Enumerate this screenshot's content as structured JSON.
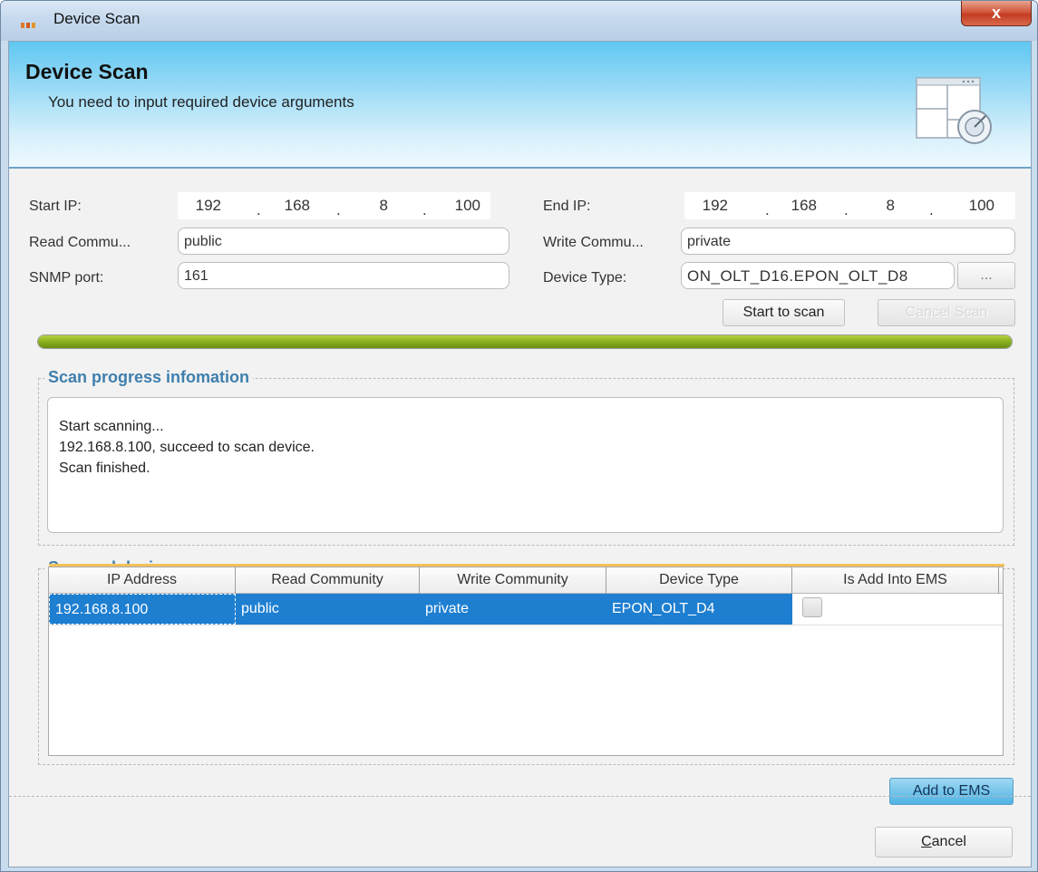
{
  "window": {
    "title": "Device Scan",
    "close_label": "x"
  },
  "header": {
    "title": "Device Scan",
    "subtitle": "You need to input required device arguments"
  },
  "form": {
    "start_ip_label": "Start IP:",
    "start_ip": [
      "192",
      "168",
      "8",
      "100"
    ],
    "end_ip_label": "End IP:",
    "end_ip": [
      "192",
      "168",
      "8",
      "100"
    ],
    "ip_separator": ".",
    "read_community_label": "Read Commu...",
    "read_community_value": "public",
    "write_community_label": "Write Commu...",
    "write_community_value": "private",
    "snmp_port_label": "SNMP port:",
    "snmp_port_value": "161",
    "device_type_label": "Device Type:",
    "device_type_value": "ON_OLT_D16.EPON_OLT_D8",
    "browse_label": "...",
    "start_scan_label": "Start to scan",
    "cancel_scan_label": "Cancel Scan"
  },
  "progress": {
    "percent": 100
  },
  "scan_progress": {
    "title": "Scan progress infomation",
    "lines": [
      "Start scanning...",
      "192.168.8.100, succeed to scan device.",
      "Scan finished."
    ]
  },
  "scanned_devices": {
    "title": "Scanned devices",
    "columns": [
      "IP Address",
      "Read Community",
      "Write Community",
      "Device Type",
      "Is Add Into EMS"
    ],
    "rows": [
      {
        "ip": "192.168.8.100",
        "read_community": "public",
        "write_community": "private",
        "device_type": "EPON_OLT_D4",
        "is_add_into_ems": false,
        "selected": true
      }
    ]
  },
  "footer": {
    "add_to_ems_label": "Add to EMS",
    "cancel_label": "Cancel"
  },
  "colors": {
    "selection": "#1e7fd1",
    "group_title": "#3f7fad",
    "progress": "#8bb321",
    "header_gradient_top": "#5fc7f2"
  }
}
